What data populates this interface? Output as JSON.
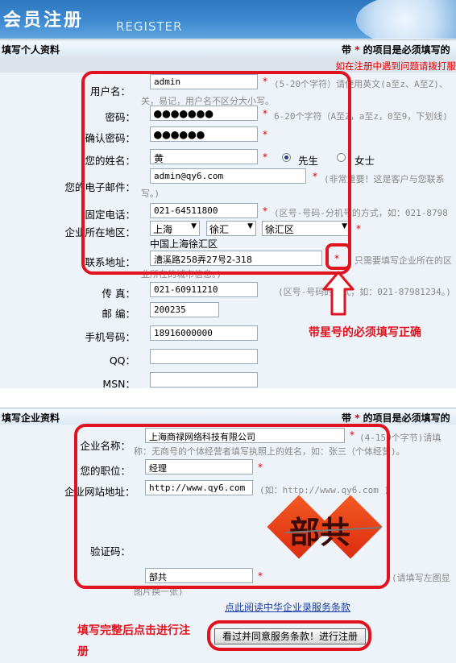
{
  "header": {
    "title": "会员注册",
    "subtitle": "REGISTER"
  },
  "personal": {
    "section_title": "填写个人资料",
    "required_note_prefix": "带",
    "required_note_star": "*",
    "required_note_suffix": "的项目是必须填写的",
    "help_text": "如在注册中遇到问题请拨打服",
    "username": {
      "label": "用户名：",
      "value": "admin",
      "hint": "(5-20个字符）请使用英文(a至z、A至Z)、",
      "hint2": "关，易记，用户名不区分大小写。"
    },
    "password": {
      "label": "密码：",
      "value": "●●●●●●●",
      "hint": "6-20个字符（A至Z，a至z，0至9，下划线)"
    },
    "confirm_password": {
      "label": "确认密码：",
      "value": "●●●●●●"
    },
    "name": {
      "label": "您的姓名：",
      "value": "黄",
      "gender_male": "先生",
      "gender_female": "女士",
      "selected_gender": "先生"
    },
    "email": {
      "label": "您的电子邮件：",
      "value": "admin@qy6.com",
      "hint": "(非常重要！这是客户与您联系",
      "hint2": "写。)"
    },
    "phone": {
      "label": "固定电话：",
      "value": "021-64511800",
      "hint": "(区号-号码-分机号的方式，如：021-8798"
    },
    "region": {
      "label": "企业所在地区：",
      "province": "上海",
      "city": "徐汇",
      "district": "徐汇区",
      "full": "中国上海徐汇区"
    },
    "address": {
      "label": "联系地址：",
      "value": "漕溪路258弄27号2-318",
      "hint": "只需要填写企业所在的区",
      "hint2": "业所在的城市信息。)"
    },
    "fax": {
      "label": "传 真：",
      "value": "021-60911210",
      "hint": "(区号-号码的方式，如：021-87981234。)"
    },
    "zip": {
      "label": "邮 编：",
      "value": "200235"
    },
    "mobile": {
      "label": "手机号码：",
      "value": "18916000000"
    },
    "qq": {
      "label": "QQ：",
      "value": ""
    },
    "msn": {
      "label": "MSN：",
      "value": ""
    },
    "annotation": "带星号的必须填写正确"
  },
  "company": {
    "section_title": "填写企业资料",
    "required_note_prefix": "带",
    "required_note_star": "*",
    "required_note_suffix": "的项目是必须填写的",
    "name": {
      "label": "企业名称：",
      "value": "上海商禄网络科技有限公司",
      "hint": "(4-150个字节)请填",
      "hint2": "称：无商号的个体经营者填写执照上的姓名，如：张三（个体经营)。"
    },
    "position": {
      "label": "您的职位：",
      "value": "经理"
    },
    "website": {
      "label": "企业网站地址：",
      "value": "http://www.qy6.com",
      "hint": "(如：http://www.qy6.com )"
    },
    "captcha": {
      "label": "验证码：",
      "image_text": "部共",
      "value": "部共",
      "hint": "(请填写左图显",
      "hint2": "图片换一张)"
    },
    "agree_link": "点此阅读中华企业录服务条款",
    "submit": "看过并同意服务条款！进行注册",
    "annotation_line1": "填写完整后点击进行注",
    "annotation_line2": "册"
  },
  "colors": {
    "accent_red": "#e0131e",
    "header_blue": "#3f8ad0",
    "link_blue": "#1b3ea8"
  }
}
